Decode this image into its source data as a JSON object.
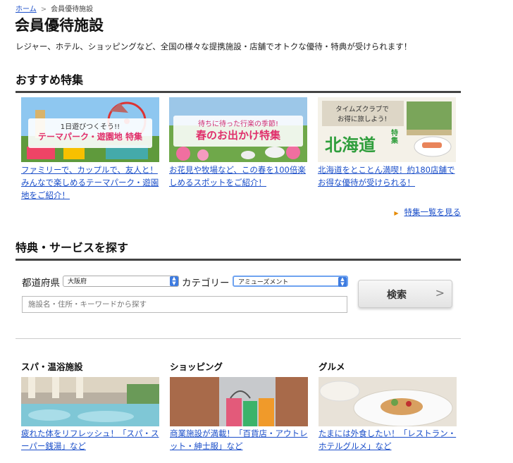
{
  "breadcrumb": {
    "home": "ホーム",
    "separator": ">",
    "current": "会員優待施設"
  },
  "page": {
    "title": "会員優待施設",
    "lead": "レジャー、ホテル、ショッピングなど、全国の様々な提携施設・店舗でオトクな優待・特典が受けられます！"
  },
  "featured": {
    "heading": "おすすめ特集",
    "items": [
      {
        "banner_line1": "1日遊びつくそう!!",
        "banner_line2": "テーマパーク・遊園地 特集",
        "link": "ファミリーで、カップルで、友人と！みんなで楽しめるテーマパーク・遊園地をご紹介！"
      },
      {
        "banner_line1": "待ちに待った行楽の季節!",
        "banner_line2": "春のお出かけ特集",
        "link": "お花見や牧場など、この春を100倍楽しめるスポットをご紹介！"
      },
      {
        "banner_line1": "タイムズクラブで",
        "banner_line2": "お得に旅しよう!",
        "banner_line3": "北海道",
        "banner_line4": "特集",
        "link": "北海道をとことん満喫！約180店舗でお得な優待が受けられる！"
      }
    ],
    "more_link": "特集一覧を見る"
  },
  "search": {
    "heading": "特典・サービスを探す",
    "prefecture_label": "都道府県",
    "prefecture_value": "大阪府",
    "category_label": "カテゴリー",
    "category_value": "アミューズメント",
    "keyword_placeholder": "施設名・住所・キーワードから探す",
    "button_label": "検索",
    "button_chevron": ">"
  },
  "categories": [
    {
      "title": "スパ・温浴施設",
      "link": "疲れた体をリフレッシュ！「スパ・スーパー銭湯」など"
    },
    {
      "title": "ショッピング",
      "link": "商業施設が満載！「百貨店・アウトレット・紳士服」など"
    },
    {
      "title": "グルメ",
      "link": "たまには外食したい！「レストラン・ホテルグルメ」など"
    }
  ],
  "colors": {
    "link": "#1a4ec9",
    "rule": "#444444",
    "arrow": "#e58a00",
    "select_accent": "#3d7be0"
  }
}
